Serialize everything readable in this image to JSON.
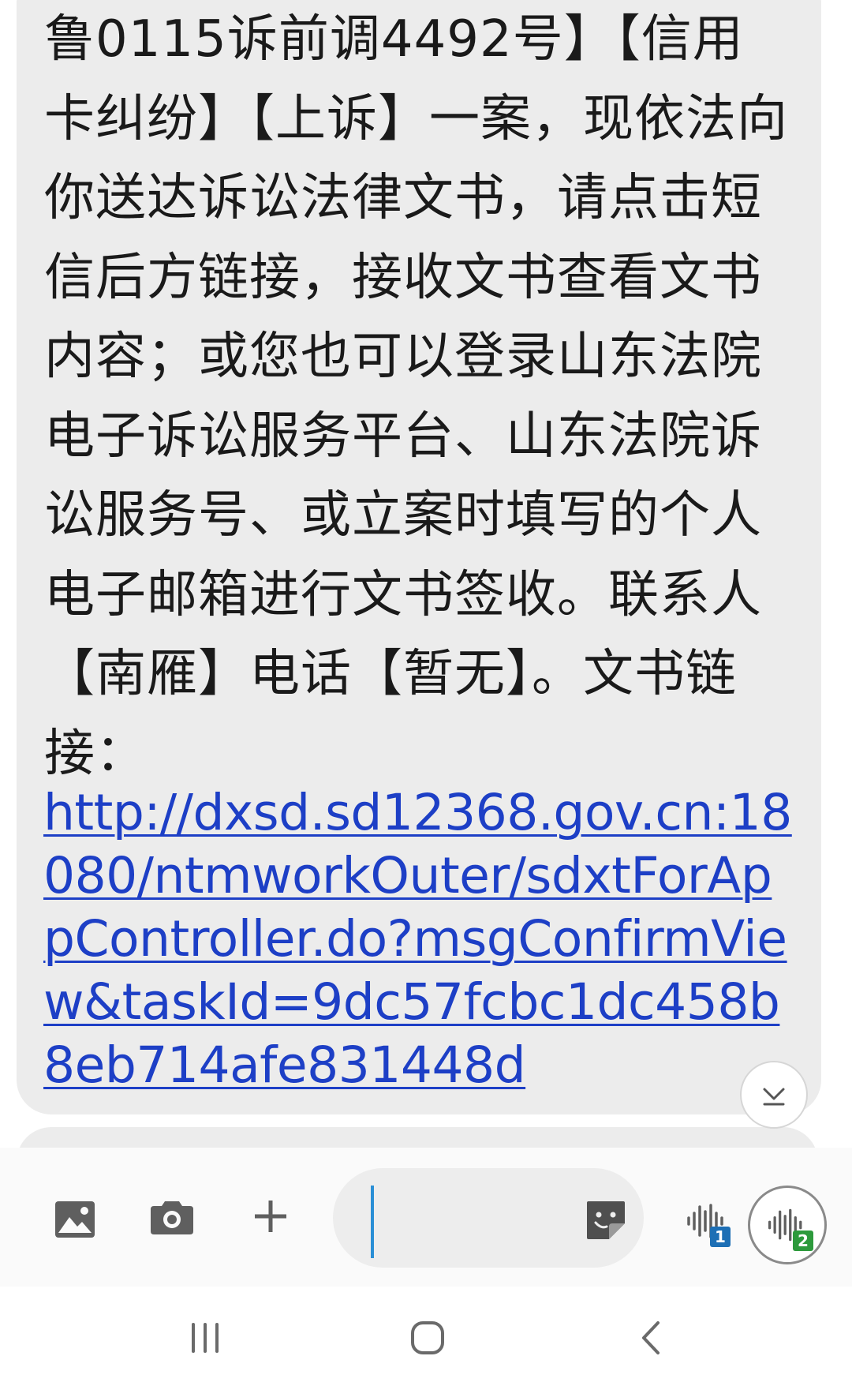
{
  "message": {
    "text": "鲁0115诉前调4492号】【信用卡纠纷】【上诉】一案，现依法向你送达诉讼法律文书，请点击短信后方链接，接收文书查看文书内容；或您也可以登录山东法院电子诉讼服务平台、山东法院诉讼服务号、或立案时填写的个人电子邮箱进行文书签收。联系人【南雁】电话【暂无】。文书链接：",
    "link": "http://dxsd.sd12368.gov.cn:18080/ntmworkOuter/sdxtForAppController.do?msgConfirmView&taskId=9dc57fcbc1dc458b8eb714afe831448d"
  },
  "composer": {
    "input_value": "",
    "sim1_badge": "1",
    "sim2_badge": "2"
  },
  "icons": {
    "scroll_down": "chevron-down-icon",
    "gallery": "image-icon",
    "camera": "camera-icon",
    "add": "plus-icon",
    "sticker": "sticker-icon",
    "voice_sim1": "voice-wave-icon",
    "voice_sim2": "voice-wave-icon",
    "nav_recent": "recent-apps-icon",
    "nav_home": "home-icon",
    "nav_back": "back-icon"
  },
  "colors": {
    "bubble": "#ececec",
    "link": "#1d3fc6",
    "caret": "#2a8fd6",
    "sim1_badge": "#1d6fb5",
    "sim2_badge": "#2d9a3c"
  }
}
